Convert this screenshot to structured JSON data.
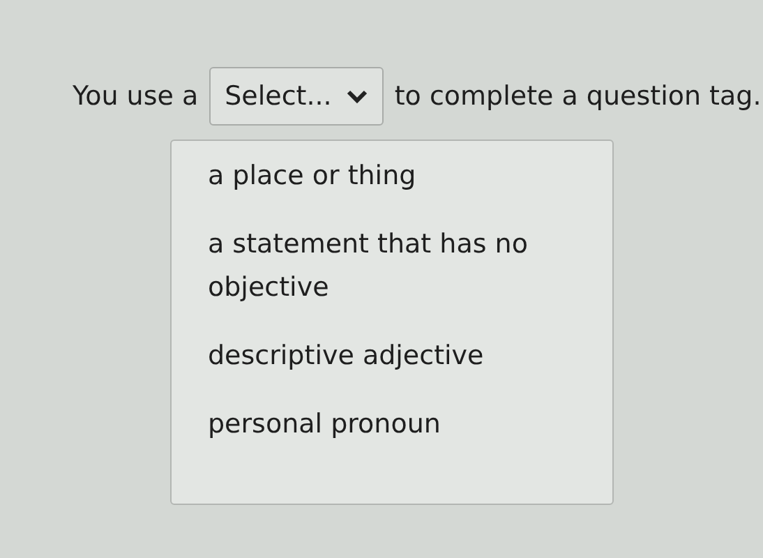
{
  "question": {
    "before": "You use a",
    "after": "to complete a question tag."
  },
  "dropdown": {
    "value": "Select...",
    "expanded": true,
    "options": [
      {
        "label": "a place or thing",
        "selected": false
      },
      {
        "label": "a statement that has no objective",
        "selected": false
      },
      {
        "label": "descriptive adjective",
        "selected": false
      },
      {
        "label": "personal pronoun",
        "selected": false
      }
    ]
  }
}
